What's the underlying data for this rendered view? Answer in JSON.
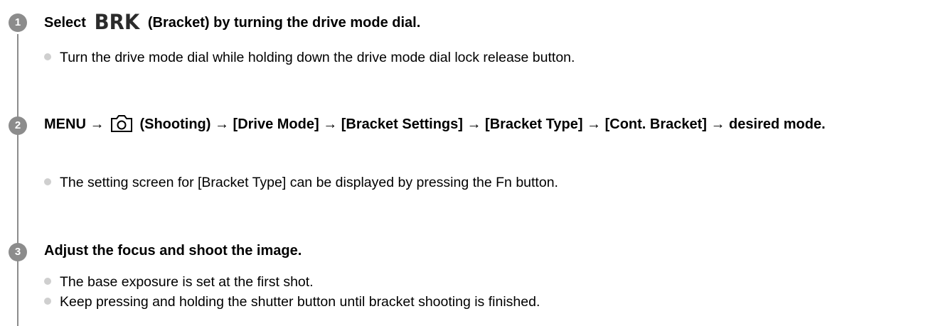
{
  "steps": [
    {
      "number": "1",
      "title_pre": "Select",
      "title_icon_text": "BRK",
      "title_post": "(Bracket) by turning the drive mode dial.",
      "bullets": [
        "Turn the drive mode dial while holding down the drive mode dial lock release button."
      ]
    },
    {
      "number": "2",
      "title_pre": "MENU →",
      "title_icon": "camera-icon",
      "title_post": "(Shooting) → [Drive Mode] → [Bracket Settings] → [Bracket Type] → [Cont. Bracket] → desired mode.",
      "bullets": [
        "The setting screen for [Bracket Type] can be displayed by pressing the Fn button."
      ]
    },
    {
      "number": "3",
      "title": "Adjust the focus and shoot the image.",
      "bullets": [
        "The base exposure is set at the first shot.",
        "Keep pressing and holding the shutter button until bracket shooting is finished."
      ]
    }
  ],
  "colors": {
    "step_circle": "#8c8c8c",
    "bullet_dot": "#cfcfcf",
    "text": "#000000"
  }
}
